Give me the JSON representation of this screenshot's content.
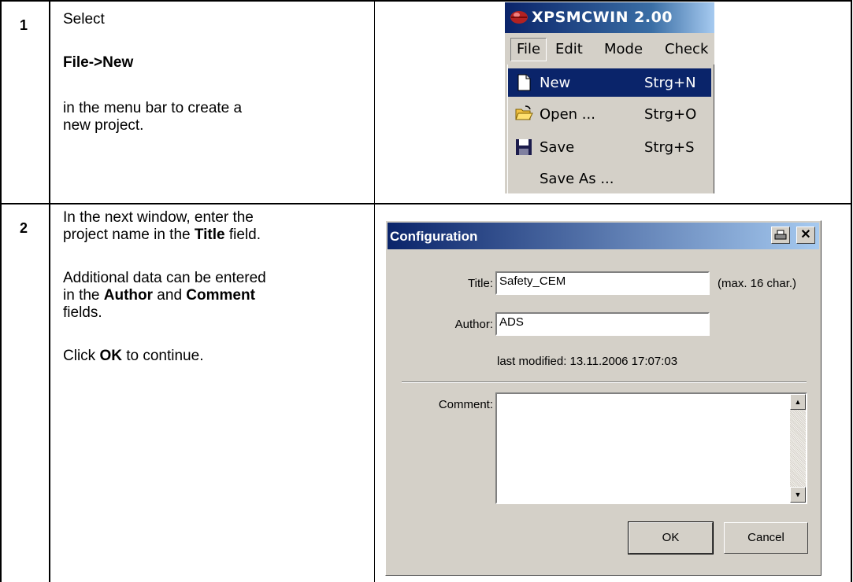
{
  "steps": [
    {
      "number": "1",
      "select": "Select",
      "path": "File->New",
      "line1": "in the menu bar to create a",
      "line2": "new project."
    },
    {
      "number": "2",
      "p1_a": "In the next window, enter the",
      "p1_b": "project name in the ",
      "p1_b_bold": "Title",
      "p1_b_end": " field.",
      "p2_a": "Additional data can be entered",
      "p2_b": "in the ",
      "p2_b_bold1": "Author",
      "p2_b_mid": " and ",
      "p2_b_bold2": "Comment",
      "p2_c": "fields.",
      "p3_a": "Click ",
      "p3_bold": "OK",
      "p3_b": " to continue."
    }
  ],
  "menu_shot": {
    "app_title": "XPSMCWIN 2.00",
    "menubar": [
      "File",
      "Edit",
      "Mode",
      "Check"
    ],
    "items": [
      {
        "label": "New",
        "shortcut": "Strg+N",
        "icon": "new-document-icon"
      },
      {
        "label": "Open ...",
        "shortcut": "Strg+O",
        "icon": "open-folder-icon"
      },
      {
        "label": "Save",
        "shortcut": "Strg+S",
        "icon": "floppy-disk-icon"
      },
      {
        "label": "Save As ...",
        "shortcut": "",
        "icon": ""
      }
    ],
    "colors": {
      "selection": "#0a246a",
      "face": "#d4d0c8"
    }
  },
  "dialog": {
    "title": "Configuration",
    "title_label": "Title:",
    "title_value": "Safety_CEM",
    "title_hint": "(max. 16 char.)",
    "author_label": "Author:",
    "author_value": "ADS",
    "last_modified": "last modified: 13.11.2006 17:07:03",
    "comment_label": "Comment:",
    "comment_value": "",
    "ok_label": "OK",
    "cancel_label": "Cancel",
    "print_icon": "printer-icon",
    "close_icon": "close-icon"
  }
}
